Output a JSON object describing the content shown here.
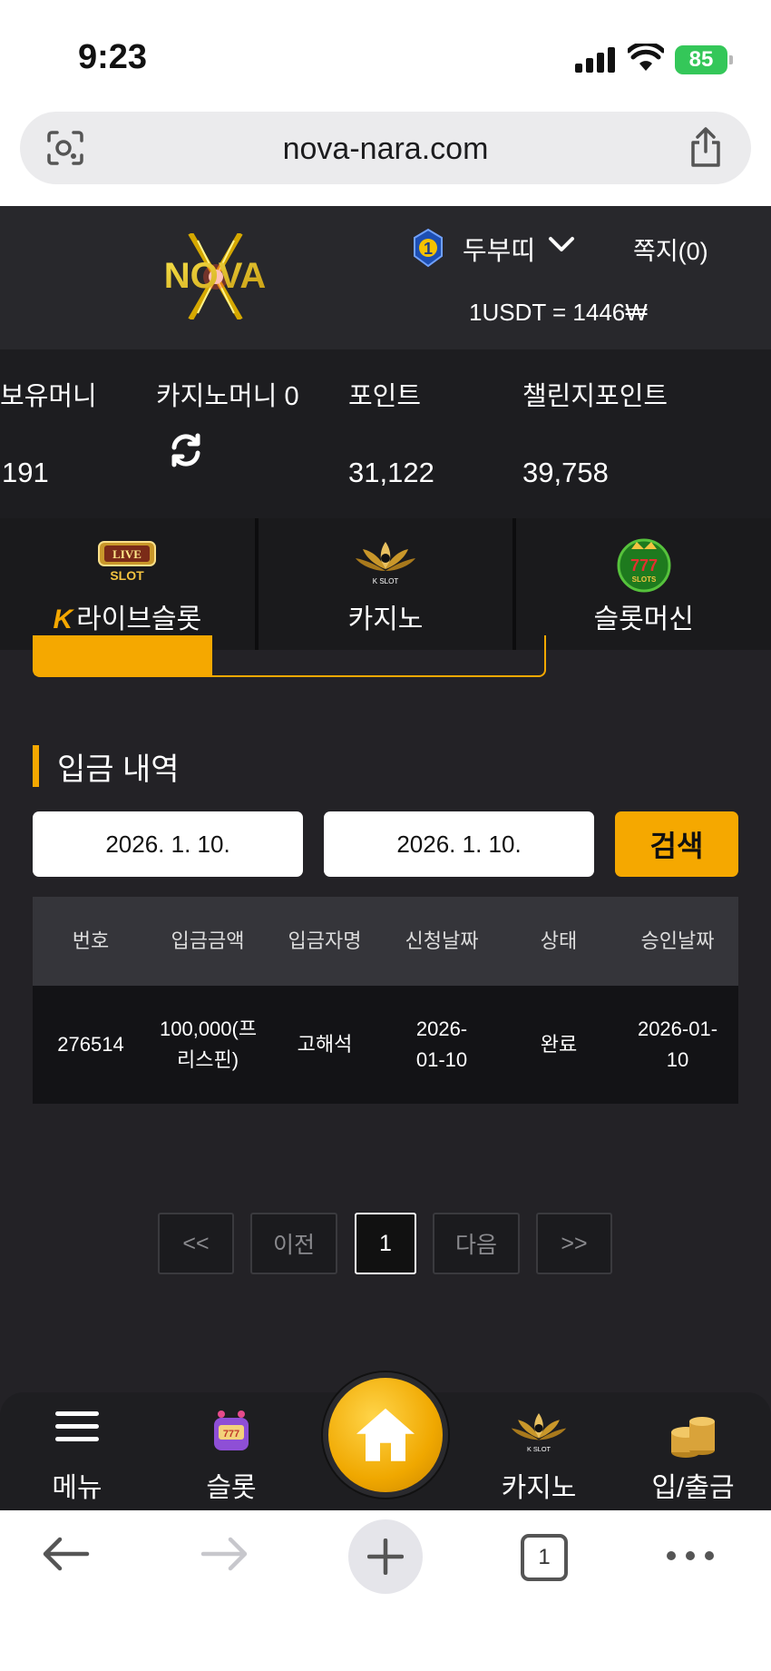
{
  "status_bar": {
    "time": "9:23",
    "battery": "85"
  },
  "browser": {
    "url": "nova-nara.com",
    "tab_count": "1"
  },
  "header": {
    "logo_text": "NOVA",
    "rank_level": "1",
    "username": "두부띠",
    "messages_label": "쪽지(0)",
    "exchange_rate": "1USDT = 1446₩"
  },
  "balance": {
    "items": [
      {
        "label": "보유머니",
        "value": "191"
      },
      {
        "label": "카지노머니 0",
        "value": ""
      },
      {
        "label": "포인트",
        "value": "31,122"
      },
      {
        "label": "챌린지포인트",
        "value": "39,758"
      }
    ]
  },
  "game_tabs": [
    {
      "label": "라이브슬롯",
      "icon": "live-slot-icon",
      "prefix": "K"
    },
    {
      "label": "카지노",
      "icon": "kslot-lotus-icon"
    },
    {
      "label": "슬롯머신",
      "icon": "777-slots-icon"
    }
  ],
  "deposit_history": {
    "title": "입금 내역",
    "start_date": "2026. 1. 10.",
    "end_date": "2026. 1. 10.",
    "search_label": "검색",
    "columns": [
      "번호",
      "입금금액",
      "입금자명",
      "신청날짜",
      "상태",
      "승인날짜"
    ],
    "rows": [
      [
        "276514",
        "100,000(프리스핀)",
        "고해석",
        "2026-01-10",
        "완료",
        "2026-01-10"
      ]
    ]
  },
  "pagination": {
    "first": "<<",
    "prev": "이전",
    "current": "1",
    "next": "다음",
    "last": ">>"
  },
  "bottom_nav": {
    "menu": "메뉴",
    "slot": "슬롯",
    "casino": "카지노",
    "deposit_withdraw": "입/출금"
  },
  "colors": {
    "accent": "#f5a800",
    "background": "#232226",
    "header": "#28282c"
  }
}
